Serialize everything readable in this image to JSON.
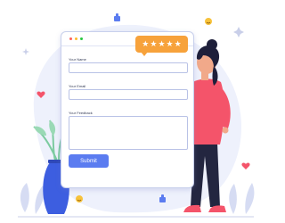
{
  "form": {
    "window_dots": [
      "red",
      "yellow",
      "green"
    ],
    "name_label": "Your Name",
    "email_label": "Your Email",
    "feedback_label": "Your Feedback",
    "submit_label": "Submit"
  },
  "rating": {
    "value": 5,
    "max": 5,
    "star_glyph": "★",
    "color": "#f7a23b"
  },
  "colors": {
    "accent": "#5b7cf0",
    "blob": "#eef1fc",
    "figure_top": "#f4546a",
    "vase": "#3d5ee0",
    "hair": "#1e1f3a"
  }
}
